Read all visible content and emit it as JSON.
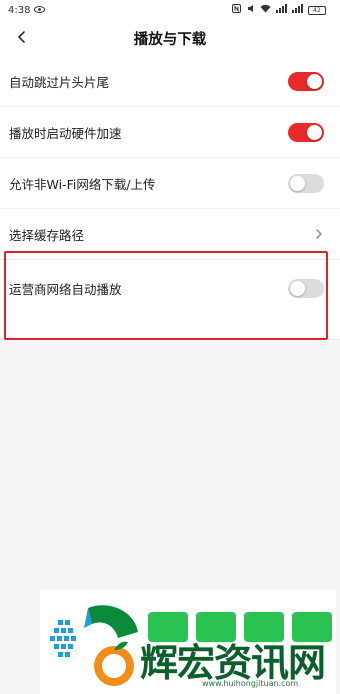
{
  "status_bar": {
    "time": "4:38",
    "battery": "42"
  },
  "header": {
    "title": "播放与下载"
  },
  "settings": [
    {
      "label": "自动跳过片头片尾",
      "toggle": true
    },
    {
      "label": "播放时启动硬件加速",
      "toggle": true
    },
    {
      "label": "允许非Wi-Fi网络下载/上传",
      "toggle": false
    },
    {
      "label": "选择缓存路径"
    },
    {
      "label": "运营商网络自动播放",
      "toggle": false
    }
  ],
  "watermark": {
    "brand": "辉宏资讯网",
    "url": "www.huihongjituan.com"
  },
  "colors": {
    "toggle_on": "#e82a2a",
    "toggle_off": "#dcdcdc",
    "highlight": "#d9252a"
  }
}
